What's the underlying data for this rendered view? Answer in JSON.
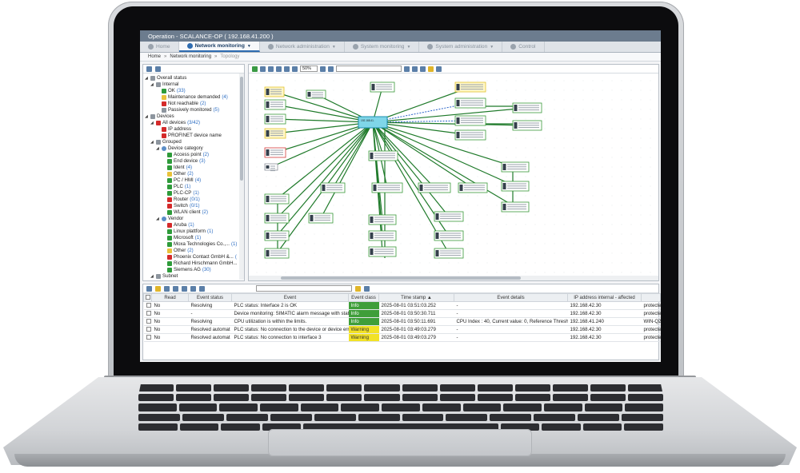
{
  "window": {
    "title": "Operation - SCALANCE-OP ( 192.168.41.200 )"
  },
  "nav": {
    "tabs": [
      {
        "label": "Home",
        "icon": "home-icon"
      },
      {
        "label": "Network monitoring",
        "icon": "network-icon",
        "active": true
      },
      {
        "label": "Network administration",
        "icon": "admin-icon"
      },
      {
        "label": "System monitoring",
        "icon": "monitor-icon"
      },
      {
        "label": "System administration",
        "icon": "system-admin-icon"
      },
      {
        "label": "Control",
        "icon": "back-arrow-icon"
      }
    ]
  },
  "breadcrumb": {
    "items": [
      "Home",
      "»",
      "Network monitoring",
      "»",
      "Topology"
    ]
  },
  "tree": {
    "items": [
      {
        "level": 0,
        "text": "Overall status",
        "icon": "gray"
      },
      {
        "level": 1,
        "text": "Internal",
        "icon": "gray"
      },
      {
        "level": 2,
        "text": "OK ",
        "count": "(33)",
        "icon": "green"
      },
      {
        "level": 2,
        "text": "Maintenance demanded ",
        "count": "(4)",
        "icon": "yellow"
      },
      {
        "level": 2,
        "text": "Not reachable ",
        "count": "(2)",
        "icon": "red"
      },
      {
        "level": 2,
        "text": "Passively monitored ",
        "count": "(5)",
        "icon": "gray"
      },
      {
        "level": 0,
        "text": "Devices",
        "icon": "gray"
      },
      {
        "level": 1,
        "text": "All devices ",
        "count": "(3/42)",
        "icon": "red"
      },
      {
        "level": 2,
        "text": "IP address",
        "count": "",
        "icon": "red"
      },
      {
        "level": 2,
        "text": "PROFINET device name",
        "count": "",
        "icon": "red"
      },
      {
        "level": 1,
        "text": "Grouped",
        "icon": "gray"
      },
      {
        "level": 2,
        "text": "Device category",
        "icon": "blue"
      },
      {
        "level": 3,
        "text": "Access point ",
        "count": "(2)",
        "icon": "green"
      },
      {
        "level": 3,
        "text": "End device ",
        "count": "(3)",
        "icon": "green"
      },
      {
        "level": 3,
        "text": "Ident ",
        "count": "(4)",
        "icon": "green"
      },
      {
        "level": 3,
        "text": "Other ",
        "count": "(2)",
        "icon": "yellow"
      },
      {
        "level": 3,
        "text": "PC / HMI ",
        "count": "(4)",
        "icon": "green"
      },
      {
        "level": 3,
        "text": "PLC ",
        "count": "(1)",
        "icon": "green"
      },
      {
        "level": 3,
        "text": "PLC-CP ",
        "count": "(1)",
        "icon": "green"
      },
      {
        "level": 3,
        "text": "Router ",
        "count": "(0/1)",
        "icon": "red"
      },
      {
        "level": 3,
        "text": "Switch ",
        "count": "(0/1)",
        "icon": "red"
      },
      {
        "level": 3,
        "text": "WLAN client ",
        "count": "(2)",
        "icon": "green"
      },
      {
        "level": 2,
        "text": "Vendor",
        "icon": "blue"
      },
      {
        "level": 3,
        "text": "Aruba ",
        "count": "(1)",
        "icon": "red"
      },
      {
        "level": 3,
        "text": "Linux plattform ",
        "count": "(1)",
        "icon": "green"
      },
      {
        "level": 3,
        "text": "Microsoft ",
        "count": "(1)",
        "icon": "green"
      },
      {
        "level": 3,
        "text": "Moxa Technologies Co.,... ",
        "count": "(1)",
        "icon": "green"
      },
      {
        "level": 3,
        "text": "Other ",
        "count": "(2)",
        "icon": "yellow"
      },
      {
        "level": 3,
        "text": "Phoenix Contact GmbH &... ",
        "count": "(",
        "icon": "red"
      },
      {
        "level": 3,
        "text": "Richard Hirschmann GmbH... ",
        "count": "",
        "icon": "green"
      },
      {
        "level": 3,
        "text": "Siemens AG ",
        "count": "(30)",
        "icon": "green"
      },
      {
        "level": 1,
        "text": "Subnet",
        "icon": "gray"
      }
    ]
  },
  "topology": {
    "zoom": "50%",
    "hub_label": "192.168.41.",
    "colors": {
      "link": "#1f7a2a",
      "link_dashed": "#2b63c8",
      "node_border_ok": "#3b9a3b",
      "node_border_warn": "#e1c12f",
      "node_border_err": "#d43a3a"
    }
  },
  "events": {
    "columns": [
      "",
      "Read",
      "Event status",
      "Event",
      "Event class",
      "Time stamp ▲",
      "Event details",
      "IP address internal - affected",
      ""
    ],
    "rows": [
      {
        "read": "No",
        "status": "Resolving",
        "event": "PLC status: Interface 2 is OK",
        "class": "Info",
        "time": "2025-08-01 03:51:03.252",
        "details": "-",
        "ip": "192.168.42.30",
        "extra": "protected"
      },
      {
        "read": "No",
        "status": "-",
        "event": "Device monitoring: SIMATIC alarm message with status \"C",
        "class": "Info",
        "time": "2025-08-01 03:50:30.711",
        "details": "-",
        "ip": "192.168.42.30",
        "extra": "protected"
      },
      {
        "read": "No",
        "status": "Resolving",
        "event": "CPU utilization is within the limits.",
        "class": "Info",
        "time": "2025-08-01 03:50:11.691",
        "details": "CPU Index : 40, Current value: 0, Reference Threshold Con",
        "ip": "192.168.41.240",
        "extra": "WIN-Q26"
      },
      {
        "read": "No",
        "status": "Resolved automat",
        "event": "PLC status: No connection to the device or device error or",
        "class": "Warning",
        "time": "2025-08-01 03:49:03.279",
        "details": "-",
        "ip": "192.168.42.30",
        "extra": "protected"
      },
      {
        "read": "No",
        "status": "Resolved automat",
        "event": "PLC status: No connection to interface 3",
        "class": "Warning",
        "time": "2025-08-01 03:49:03.279",
        "details": "-",
        "ip": "192.168.42.30",
        "extra": "protected"
      }
    ]
  }
}
